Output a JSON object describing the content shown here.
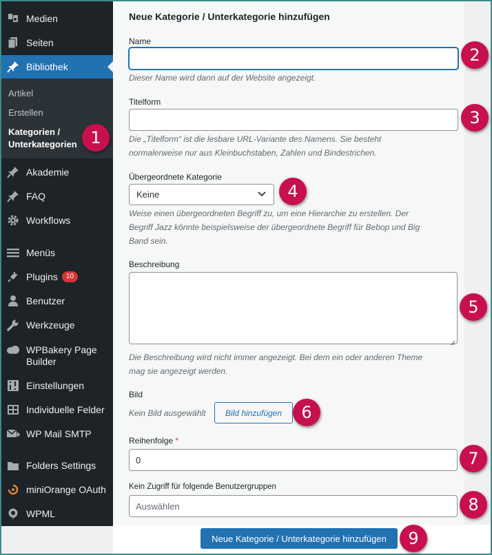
{
  "colors": {
    "sidebar_bg": "#1d2327",
    "submenu_bg": "#2c3338",
    "active_bg": "#2271b1",
    "badge_bg": "#d63638",
    "callout_bg": "#c8104f",
    "primary": "#2271b1"
  },
  "sidebar": {
    "items_top": [
      {
        "label": "Medien",
        "icon": "media-icon"
      },
      {
        "label": "Seiten",
        "icon": "pages-icon"
      },
      {
        "label": "Bibliothek",
        "icon": "pin-icon"
      }
    ],
    "submenu": [
      {
        "label": "Artikel"
      },
      {
        "label": "Erstellen"
      },
      {
        "label_line1": "Kategorien /",
        "label_line2": "Unterkategorien"
      }
    ],
    "items_bottom": [
      {
        "label": "Akademie",
        "icon": "pin-icon"
      },
      {
        "label": "FAQ",
        "icon": "pin-icon"
      },
      {
        "label": "Workflows",
        "icon": "gear-icon"
      },
      {
        "label": "Menüs",
        "icon": "menu-icon"
      },
      {
        "label": "Plugins",
        "icon": "plugin-icon",
        "badge": "10"
      },
      {
        "label": "Benutzer",
        "icon": "user-icon"
      },
      {
        "label": "Werkzeuge",
        "icon": "wrench-icon"
      },
      {
        "label_line1": "WPBakery Page",
        "label_line2": "Builder",
        "icon": "cloud-icon"
      },
      {
        "label": "Einstellungen",
        "icon": "settings-sliders-icon"
      },
      {
        "label": "Individuelle Felder",
        "icon": "fields-icon"
      },
      {
        "label": "WP Mail SMTP",
        "icon": "mail-icon"
      },
      {
        "label": "Folders Settings",
        "icon": "folder-icon"
      },
      {
        "label": "miniOrange OAuth",
        "icon": "miniorange-icon"
      },
      {
        "label": "WPML",
        "icon": "wpml-icon"
      }
    ]
  },
  "form": {
    "title": "Neue Kategorie / Unterkategorie hinzufügen",
    "name": {
      "label": "Name",
      "value": "",
      "desc": "Dieser Name wird dann auf der Website angezeigt."
    },
    "slug": {
      "label": "Titelform",
      "value": "",
      "desc_line1": "Die „Titelform“ ist die lesbare URL-Variante des Namens. Sie besteht",
      "desc_line2": "normalerweise nur aus Kleinbuchstaben, Zahlen und Bindestrichen."
    },
    "parent": {
      "label": "Übergeordnete Kategorie",
      "selected": "Keine",
      "desc_line1": "Weise einen übergeordneten Begriff zu, um eine Hierarchie zu erstellen. Der",
      "desc_line2": "Begriff Jazz könnte beispielsweise der übergeordnete Begriff für Bebop und Big",
      "desc_line3": "Band sein."
    },
    "description": {
      "label": "Beschreibung",
      "value": "",
      "desc_line1": "Die Beschreibung wird nicht immer angezeigt. Bei dem ein oder anderen Theme",
      "desc_line2": "mag sie angezeigt werden."
    },
    "image": {
      "label": "Bild",
      "status": "Kein Bild ausgewählt",
      "button": "Bild hinzufügen"
    },
    "order": {
      "label": "Reihenfolge",
      "required_mark": "*",
      "value": "0"
    },
    "access": {
      "label": "Kein Zugriff für folgende Benutzergruppen",
      "placeholder": "Auswählen"
    },
    "submit": "Neue Kategorie / Unterkategorie hinzufügen"
  },
  "callouts": [
    "1",
    "2",
    "3",
    "4",
    "5",
    "6",
    "7",
    "8",
    "9"
  ]
}
